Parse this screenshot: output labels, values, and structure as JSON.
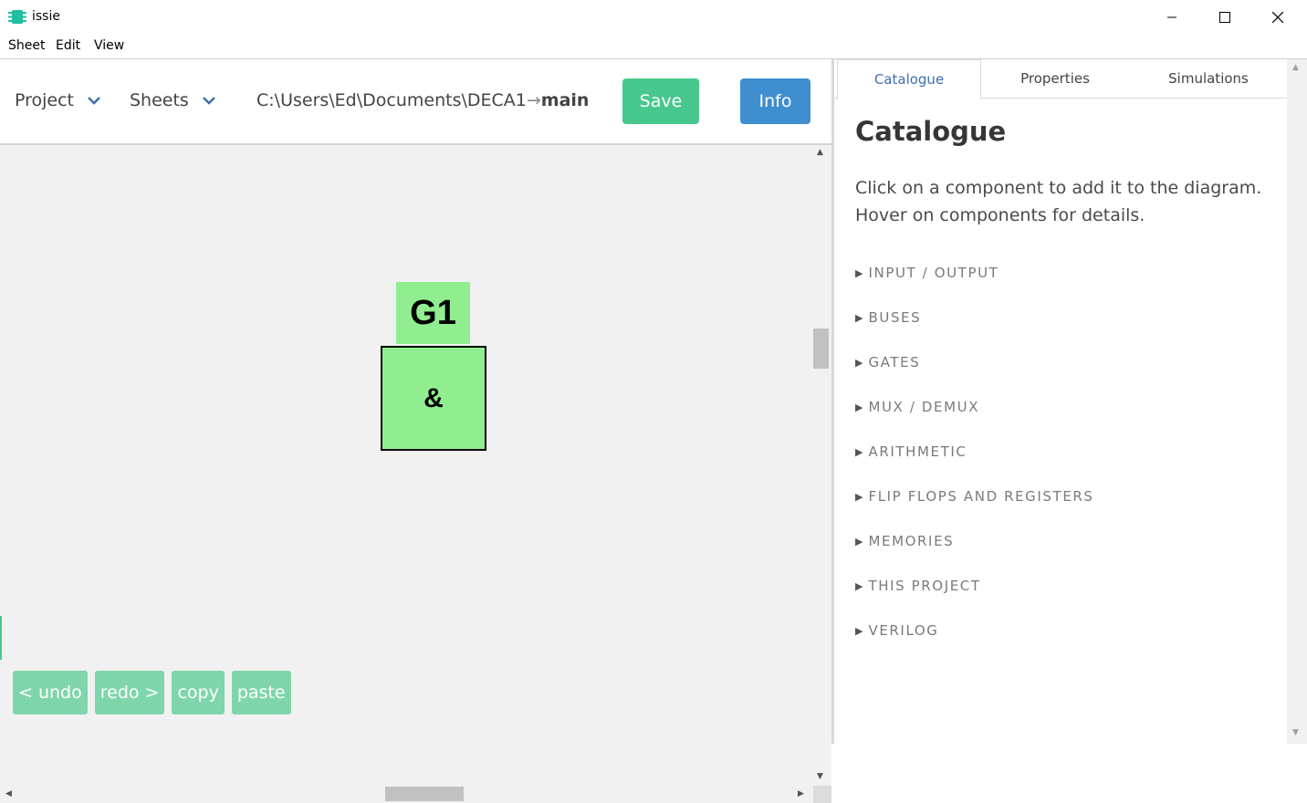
{
  "window": {
    "title": "issie"
  },
  "menubar": {
    "items": [
      "Sheet",
      "Edit",
      "View"
    ]
  },
  "topbar": {
    "project_label": "Project",
    "sheets_label": "Sheets",
    "path_prefix": "C:\\Users\\Ed\\Documents\\DECA1",
    "path_arrow": "→",
    "path_sheet": "main",
    "save_label": "Save",
    "info_label": "Info"
  },
  "canvas": {
    "component_label": "G1",
    "component_symbol": "&",
    "edit_buttons": [
      "< undo",
      "redo >",
      "copy",
      "paste"
    ]
  },
  "right_panel": {
    "tabs": [
      "Catalogue",
      "Properties",
      "Simulations"
    ],
    "active_tab": "Catalogue",
    "title": "Catalogue",
    "description_line1": "Click on a component to add it to the diagram.",
    "description_line2": "Hover on components for details.",
    "categories": [
      "INPUT / OUTPUT",
      "BUSES",
      "GATES",
      "MUX / DEMUX",
      "ARITHMETIC",
      "FLIP FLOPS AND REGISTERS",
      "MEMORIES",
      "THIS PROJECT",
      "VERILOG"
    ]
  },
  "colors": {
    "save_green": "#48c78e",
    "info_blue": "#3e8ed0",
    "component_green": "#90ee90",
    "edit_button_green": "#7fd6ac",
    "canvas_bg": "#f1f1f1"
  }
}
